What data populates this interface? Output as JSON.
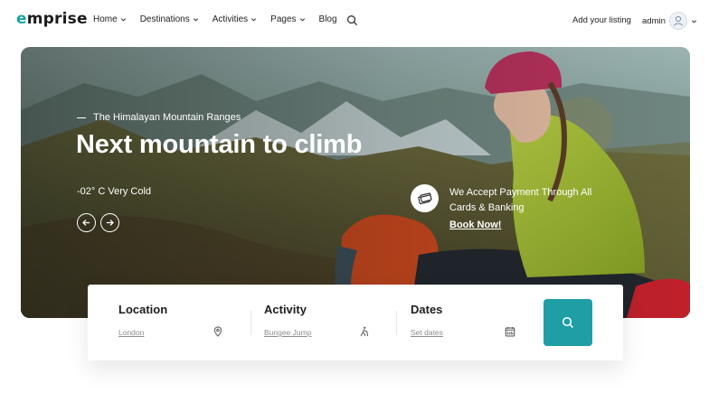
{
  "header": {
    "logo": {
      "first": "e",
      "rest": "mprise"
    },
    "nav": [
      {
        "label": "Home",
        "has_dropdown": true
      },
      {
        "label": "Destinations",
        "has_dropdown": true
      },
      {
        "label": "Activities",
        "has_dropdown": true
      },
      {
        "label": "Pages",
        "has_dropdown": true
      },
      {
        "label": "Blog",
        "has_dropdown": false
      }
    ],
    "search_icon": "search-icon",
    "add_listing": "Add your listing",
    "user": {
      "name": "admin",
      "icon": "user-avatar-icon"
    }
  },
  "hero": {
    "eyebrow": "The Himalayan Mountain Ranges",
    "headline": "Next mountain to climb",
    "weather": "-02° C Very Cold",
    "payment_text": "We Accept Payment Through All Cards & Banking",
    "book_now": "Book Now!",
    "payment_icon": "credit-card-icon",
    "prev_icon": "arrow-left-icon",
    "next_icon": "arrow-right-icon"
  },
  "search": {
    "fields": [
      {
        "title": "Location",
        "value": "London",
        "icon": "map-pin-icon"
      },
      {
        "title": "Activity",
        "value": "Bungee Jump",
        "icon": "hiking-icon"
      },
      {
        "title": "Dates",
        "value": "Set dates",
        "icon": "calendar-icon"
      }
    ],
    "button_icon": "search-icon"
  },
  "colors": {
    "brand": "#1aa3a8",
    "search_button": "#1f9ea6",
    "text_dark": "#1d1d1d",
    "muted": "#8c8c8c"
  }
}
